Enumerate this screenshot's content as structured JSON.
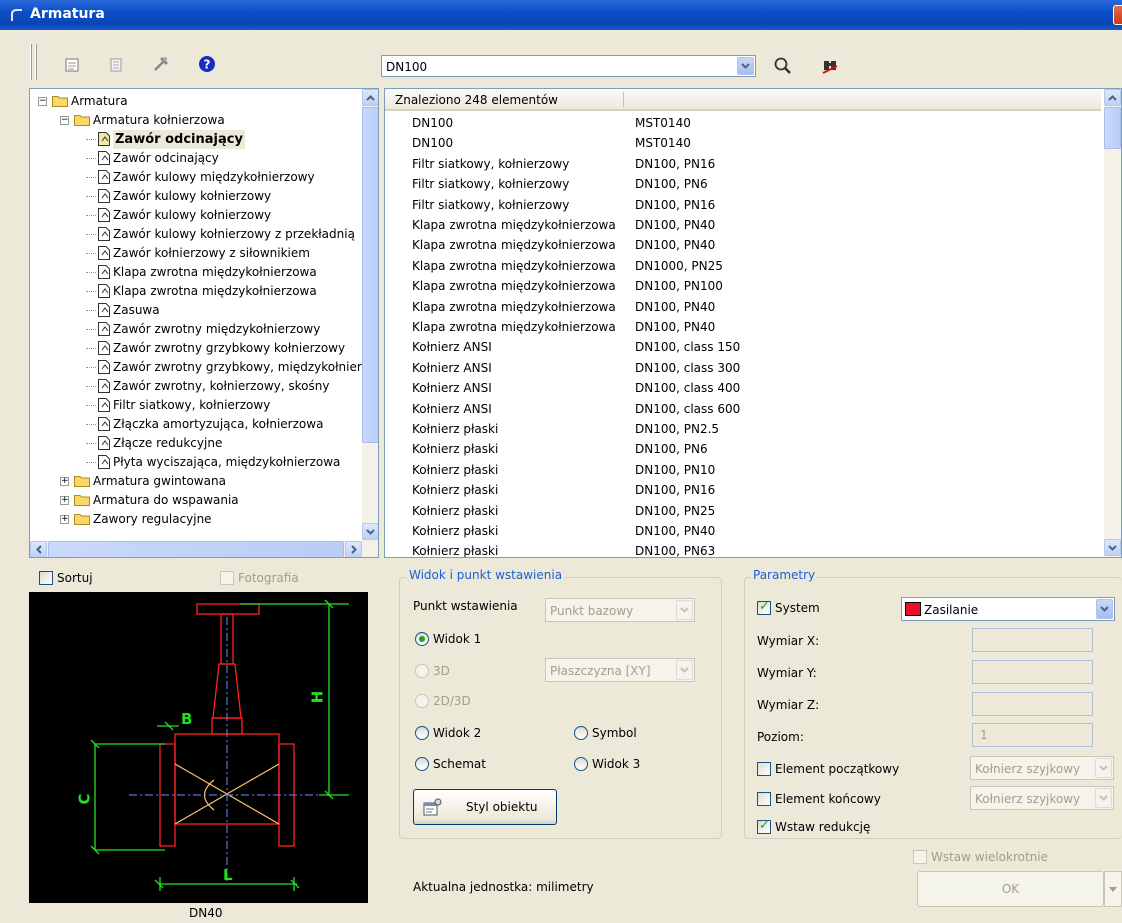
{
  "window": {
    "title": "Armatura"
  },
  "toolbar": {
    "search_value": "DN100"
  },
  "tree": {
    "items": [
      {
        "label": "Armatura",
        "level": 0,
        "kind": "folder",
        "expanded": true
      },
      {
        "label": "Armatura kołnierzowa",
        "level": 1,
        "kind": "folder",
        "expanded": true
      },
      {
        "label": "Zawór odcinający",
        "level": 2,
        "kind": "doc",
        "selected": true
      },
      {
        "label": "Zawór odcinający",
        "level": 2,
        "kind": "doc"
      },
      {
        "label": "Zawór kulowy międzykołnierzowy",
        "level": 2,
        "kind": "doc"
      },
      {
        "label": "Zawór kulowy kołnierzowy",
        "level": 2,
        "kind": "doc"
      },
      {
        "label": "Zawór kulowy kołnierzowy",
        "level": 2,
        "kind": "doc"
      },
      {
        "label": "Zawór kulowy kołnierzowy z przekładnią",
        "level": 2,
        "kind": "doc"
      },
      {
        "label": "Zawór kołnierzowy z siłownikiem",
        "level": 2,
        "kind": "doc"
      },
      {
        "label": "Klapa zwrotna międzykołnierzowa",
        "level": 2,
        "kind": "doc"
      },
      {
        "label": "Klapa zwrotna międzykołnierzowa",
        "level": 2,
        "kind": "doc"
      },
      {
        "label": "Zasuwa",
        "level": 2,
        "kind": "doc"
      },
      {
        "label": "Zawór zwrotny międzykołnierzowy",
        "level": 2,
        "kind": "doc"
      },
      {
        "label": "Zawór zwrotny grzybkowy kołnierzowy",
        "level": 2,
        "kind": "doc"
      },
      {
        "label": "Zawór zwrotny grzybkowy, międzykołnierzowy",
        "level": 2,
        "kind": "doc"
      },
      {
        "label": "Zawór zwrotny, kołnierzowy, skośny",
        "level": 2,
        "kind": "doc"
      },
      {
        "label": "Filtr siatkowy, kołnierzowy",
        "level": 2,
        "kind": "doc"
      },
      {
        "label": "Złączka amortyzująca, kołnierzowa",
        "level": 2,
        "kind": "doc"
      },
      {
        "label": "Złącze redukcyjne",
        "level": 2,
        "kind": "doc"
      },
      {
        "label": "Płyta wyciszająca, międzykołnierzowa",
        "level": 2,
        "kind": "doc"
      },
      {
        "label": "Armatura gwintowana",
        "level": 1,
        "kind": "folder",
        "expanded": false
      },
      {
        "label": "Armatura do wspawania",
        "level": 1,
        "kind": "folder",
        "expanded": false
      },
      {
        "label": "Zawory regulacyjne",
        "level": 1,
        "kind": "folder",
        "expanded": false
      }
    ]
  },
  "results": {
    "header": "Znaleziono 248 elementów",
    "rows": [
      [
        "DN100",
        "MST0140"
      ],
      [
        "DN100",
        "MST0140"
      ],
      [
        "Filtr siatkowy, kołnierzowy",
        "DN100, PN16"
      ],
      [
        "Filtr siatkowy, kołnierzowy",
        "DN100, PN6"
      ],
      [
        "Filtr siatkowy, kołnierzowy",
        "DN100, PN16"
      ],
      [
        "Klapa zwrotna międzykołnierzowa",
        "DN100, PN40"
      ],
      [
        "Klapa zwrotna międzykołnierzowa",
        "DN100, PN40"
      ],
      [
        "Klapa zwrotna międzykołnierzowa",
        "DN1000, PN25"
      ],
      [
        "Klapa zwrotna międzykołnierzowa",
        "DN100, PN100"
      ],
      [
        "Klapa zwrotna międzykołnierzowa",
        "DN100, PN40"
      ],
      [
        "Klapa zwrotna międzykołnierzowa",
        "DN100, PN40"
      ],
      [
        "Kołnierz ANSI",
        "DN100, class 150"
      ],
      [
        "Kołnierz ANSI",
        "DN100, class 300"
      ],
      [
        "Kołnierz ANSI",
        "DN100, class 400"
      ],
      [
        "Kołnierz ANSI",
        "DN100, class 600"
      ],
      [
        "Kołnierz płaski",
        "DN100, PN2.5"
      ],
      [
        "Kołnierz płaski",
        "DN100, PN6"
      ],
      [
        "Kołnierz płaski",
        "DN100, PN10"
      ],
      [
        "Kołnierz płaski",
        "DN100, PN16"
      ],
      [
        "Kołnierz płaski",
        "DN100, PN25"
      ],
      [
        "Kołnierz płaski",
        "DN100, PN40"
      ],
      [
        "Kołnierz płaski",
        "DN100, PN63"
      ]
    ]
  },
  "options": {
    "sort_label": "Sortuj",
    "photo_label": "Fotografia"
  },
  "preview": {
    "label_B": "B",
    "label_H": "H",
    "label_C": "C",
    "label_L": "L",
    "caption": "DN40",
    "colors": {
      "background": "#000000",
      "outline": "#ff2020",
      "dimension": "#22e022",
      "axis": "#6a8cff",
      "cross": "#ffc070"
    }
  },
  "view_group": {
    "legend": "Widok i punkt wstawienia",
    "insert_point_label": "Punkt wstawienia",
    "insert_point_value": "Punkt bazowy",
    "view1": "Widok 1",
    "r3d": "3D",
    "plane_value": "Płaszczyzna [XY]",
    "r2d3d": "2D/3D",
    "view2": "Widok 2",
    "symbol": "Symbol",
    "schemat": "Schemat",
    "view3": "Widok 3",
    "style_button": "Styl obiektu",
    "unit_text": "Aktualna jednostka: milimetry"
  },
  "params": {
    "legend": "Parametry",
    "system_label": "System",
    "system_value": "Zasilanie",
    "system_color": "#e8102a",
    "dim_x": "Wymiar X:",
    "dim_y": "Wymiar Y:",
    "dim_z": "Wymiar Z:",
    "level_label": "Poziom:",
    "level_value": "1",
    "start_elem": "Element początkowy",
    "start_value": "Kołnierz szyjkowy",
    "end_elem": "Element końcowy",
    "end_value": "Kołnierz szyjkowy",
    "insert_reduction": "Wstaw redukcję",
    "insert_multiple": "Wstaw wielokrotnie",
    "ok": "OK"
  }
}
